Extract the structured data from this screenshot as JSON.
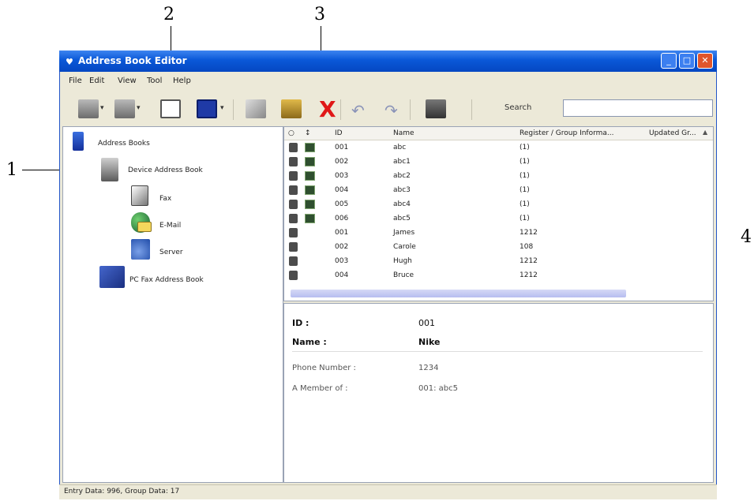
{
  "callouts": {
    "c1": "1",
    "c2": "2",
    "c3": "3",
    "c4": "4"
  },
  "window": {
    "title": "Address Book Editor",
    "title_icon": "♥",
    "min": "_",
    "max": "□",
    "close": "✕"
  },
  "menu": [
    "File",
    "Edit",
    "View",
    "Tool",
    "Help"
  ],
  "toolbar": {
    "delete_glyph": "X",
    "undo_glyph": "↶",
    "redo_glyph": "↷",
    "dropdown_glyph": "▾",
    "search_label": "Search",
    "search_value": "",
    "icons": [
      "new-user-icon",
      "new-group-icon",
      "address-card-icon",
      "save-icon",
      "copy-icon",
      "paste-icon",
      "delete-icon",
      "undo-icon",
      "redo-icon",
      "address-book-icon"
    ]
  },
  "tree": {
    "root": "Address Books",
    "device": "Device Address Book",
    "fax": "Fax",
    "email": "E-Mail",
    "server": "Server",
    "pc_fax": "PC Fax Address Book"
  },
  "list": {
    "columns": [
      "ID",
      "Name",
      "Register / Group Informa...",
      "Updated Gr..."
    ],
    "rows": [
      {
        "id": "001",
        "name": "abc",
        "info": "(1)"
      },
      {
        "id": "002",
        "name": "abc1",
        "info": "(1)"
      },
      {
        "id": "003",
        "name": "abc2",
        "info": "(1)"
      },
      {
        "id": "004",
        "name": "abc3",
        "info": "(1)"
      },
      {
        "id": "005",
        "name": "abc4",
        "info": "(1)"
      },
      {
        "id": "006",
        "name": "abc5",
        "info": "(1)"
      },
      {
        "id": "001",
        "name": "James",
        "info": "1212"
      },
      {
        "id": "002",
        "name": "Carole",
        "info": "108"
      },
      {
        "id": "003",
        "name": "Hugh",
        "info": "1212"
      },
      {
        "id": "004",
        "name": "Bruce",
        "info": "1212"
      }
    ]
  },
  "detail": {
    "id_label": "ID :",
    "id_value": "001",
    "name_label": "Name :",
    "name_value": "Nike",
    "phone_label": "Phone Number :",
    "phone_value": "1234",
    "member_label": "A Member of :",
    "member_value": "001: abc5"
  },
  "status": "Entry Data: 996, Group Data: 17"
}
